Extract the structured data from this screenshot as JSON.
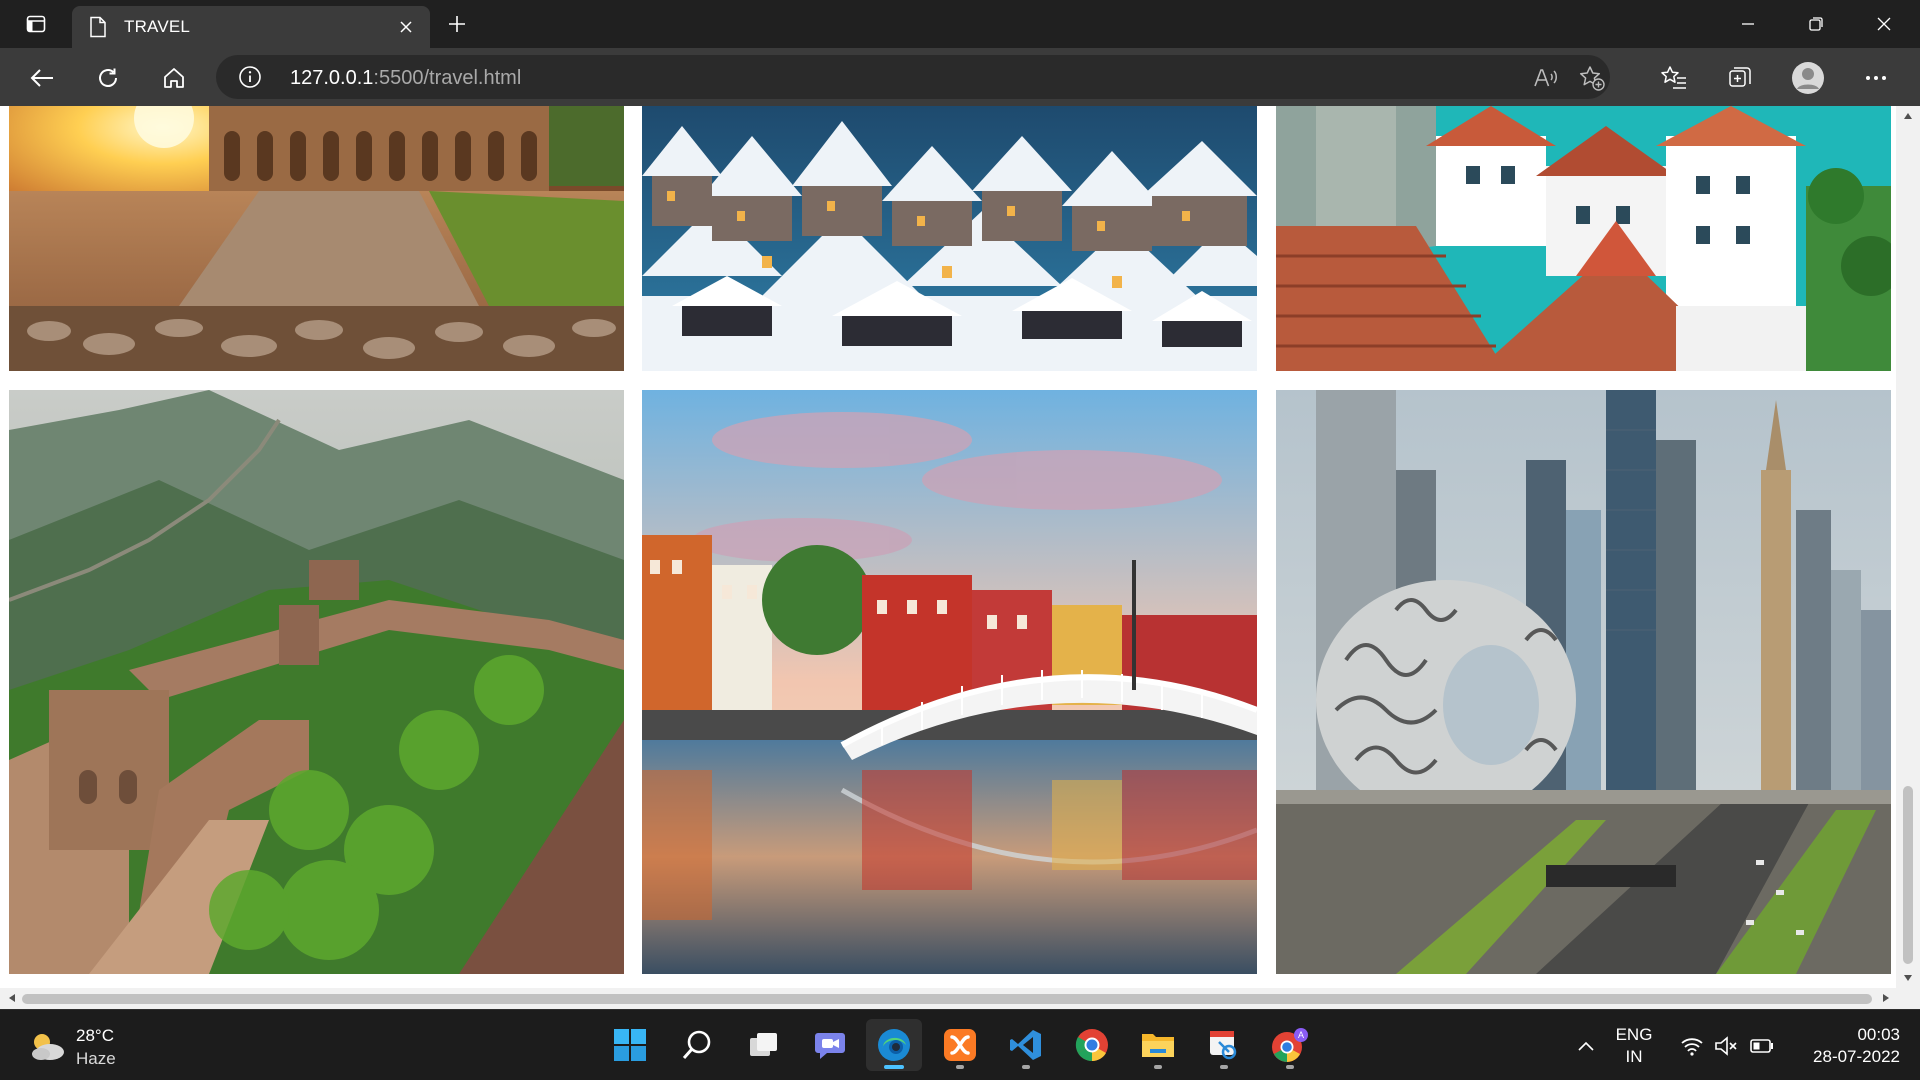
{
  "browser": {
    "tab_title": "TRAVEL",
    "address_host": "127.0.0.1",
    "address_rest": ":5500/travel.html",
    "icons": {
      "tab_actions": "tab-actions-icon",
      "page": "document-icon",
      "close_tab": "close-icon",
      "new_tab": "plus-icon",
      "back": "back-arrow-icon",
      "refresh": "refresh-icon",
      "home": "home-icon",
      "site_info": "info-icon",
      "read_aloud": "read-aloud-icon",
      "add_favorite": "star-plus-icon",
      "favorites": "favorites-icon",
      "collections": "collections-icon",
      "profile": "avatar-icon",
      "menu": "more-icon"
    }
  },
  "gallery": {
    "photos": [
      {
        "name": "photo-colosseum-sunset",
        "subject": "Colosseum, Rome"
      },
      {
        "name": "photo-snowy-village",
        "subject": "Snowy village rooftops"
      },
      {
        "name": "photo-mediterranean-rooftops",
        "subject": "Mediterranean rooftops"
      },
      {
        "name": "photo-great-wall",
        "subject": "Great Wall of China"
      },
      {
        "name": "photo-hapenny-bridge",
        "subject": "Ha'penny Bridge, Dublin"
      },
      {
        "name": "photo-museum-of-the-future",
        "subject": "Museum of the Future, Dubai"
      }
    ]
  },
  "taskbar": {
    "weather_temp": "28°C",
    "weather_desc": "Haze",
    "apps": [
      "start",
      "search",
      "task-view",
      "chat",
      "edge",
      "xampp",
      "vscode",
      "chrome",
      "file-explorer",
      "snipping-tool",
      "chrome-profile"
    ],
    "lang_line1": "ENG",
    "lang_line2": "IN",
    "time": "00:03",
    "date": "28-07-2022"
  },
  "colors": {
    "titlebar": "#202020",
    "toolbar": "#3b3b3b",
    "edge_accent": "#4cc2ff"
  }
}
